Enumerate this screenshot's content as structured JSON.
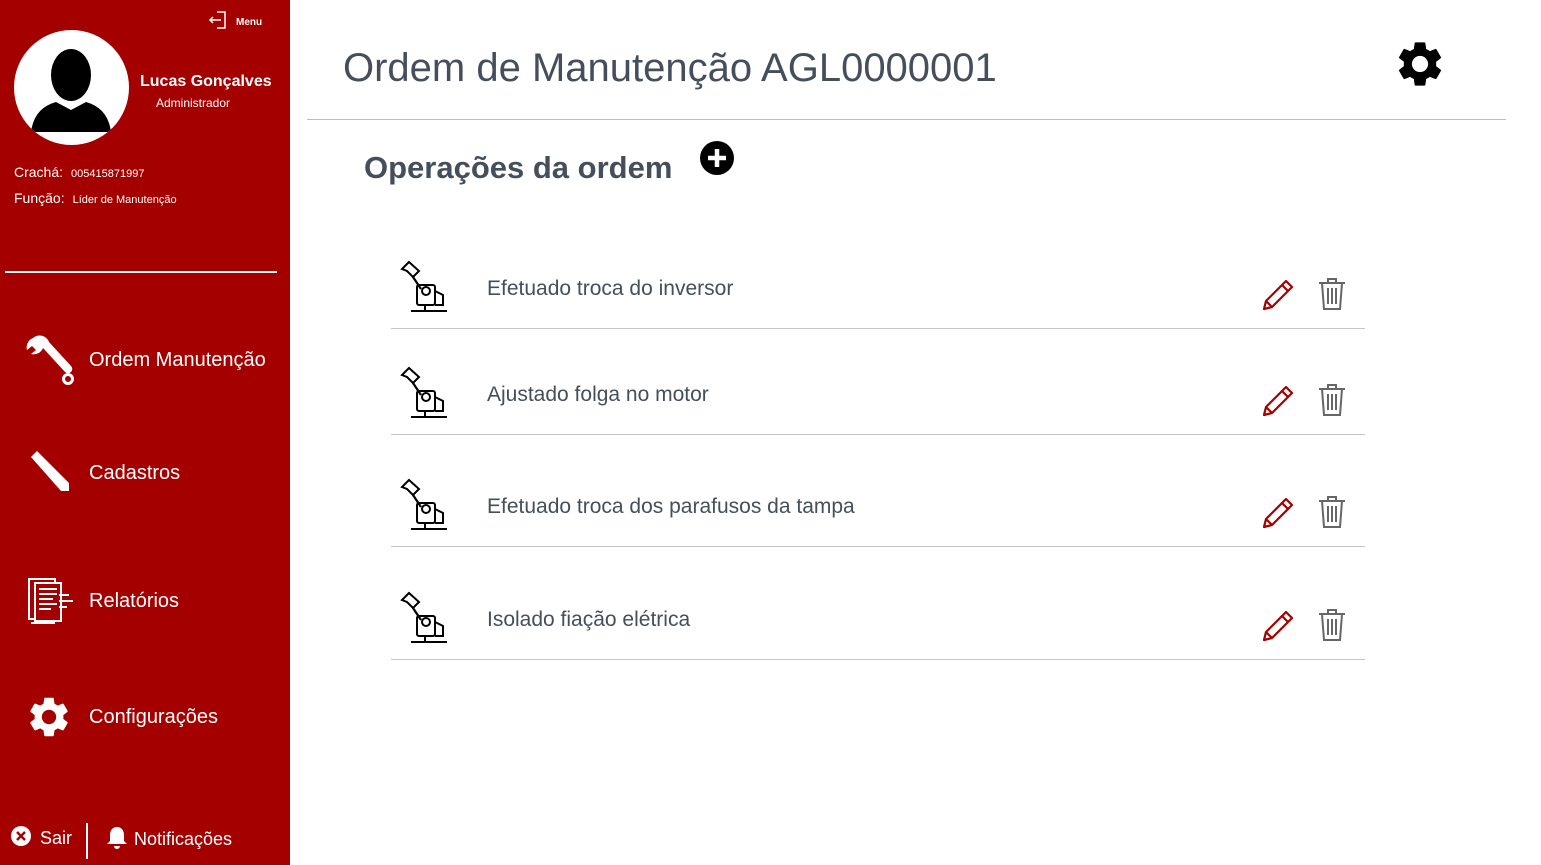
{
  "sidebar": {
    "menu_label": "Menu",
    "user": {
      "name": "Lucas Gonçalves",
      "role": "Administrador",
      "badge_label": "Crachá:",
      "badge_value": "005415871997",
      "function_label": "Função:",
      "function_value": "Líder de Manutenção"
    },
    "nav": [
      {
        "label": "Ordem Manutenção",
        "icon": "wrench-icon"
      },
      {
        "label": "Cadastros",
        "icon": "pencil-icon"
      },
      {
        "label": "Relatórios",
        "icon": "report-icon"
      },
      {
        "label": "Configurações",
        "icon": "gear-icon"
      }
    ],
    "logout_label": "Sair",
    "notifications_label": "Notificações"
  },
  "header": {
    "title": "Ordem de Manutenção AGL0000001"
  },
  "section": {
    "title": "Operações da ordem"
  },
  "operations": [
    {
      "text": "Efetuado troca do inversor"
    },
    {
      "text": "Ajustado folga no motor"
    },
    {
      "text": "Efetuado troca dos parafusos da tampa"
    },
    {
      "text": "Isolado fiação elétrica"
    }
  ],
  "colors": {
    "sidebar_bg": "#a50000",
    "text_main": "#454f5b",
    "accent_icon": "#a50000",
    "trash_icon": "#666666"
  }
}
